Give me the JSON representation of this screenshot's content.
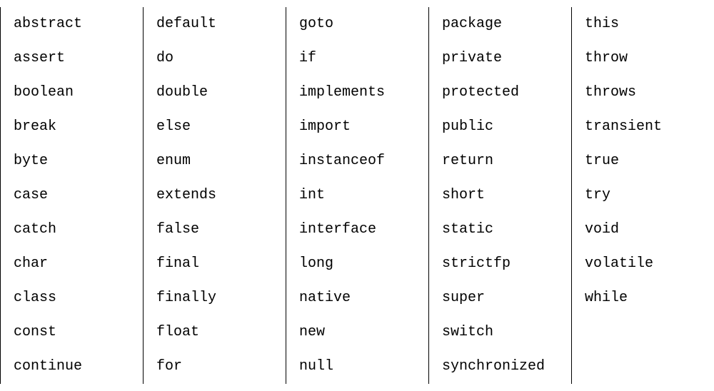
{
  "keywords": {
    "columns": [
      [
        "abstract",
        "assert",
        "boolean",
        "break",
        "byte",
        "case",
        "catch",
        "char",
        "class",
        "const",
        "continue"
      ],
      [
        "default",
        "do",
        "double",
        "else",
        "enum",
        "extends",
        "false",
        "final",
        "finally",
        "float",
        "for"
      ],
      [
        "goto",
        "if",
        "implements",
        "import",
        "instanceof",
        "int",
        "interface",
        "long",
        "native",
        "new",
        "null"
      ],
      [
        "package",
        "private",
        "protected",
        "public",
        "return",
        "short",
        "static",
        "strictfp",
        "super",
        "switch",
        "synchronized"
      ],
      [
        "this",
        "throw",
        "throws",
        "transient",
        "true",
        "try",
        "void",
        "volatile",
        "while"
      ]
    ]
  }
}
